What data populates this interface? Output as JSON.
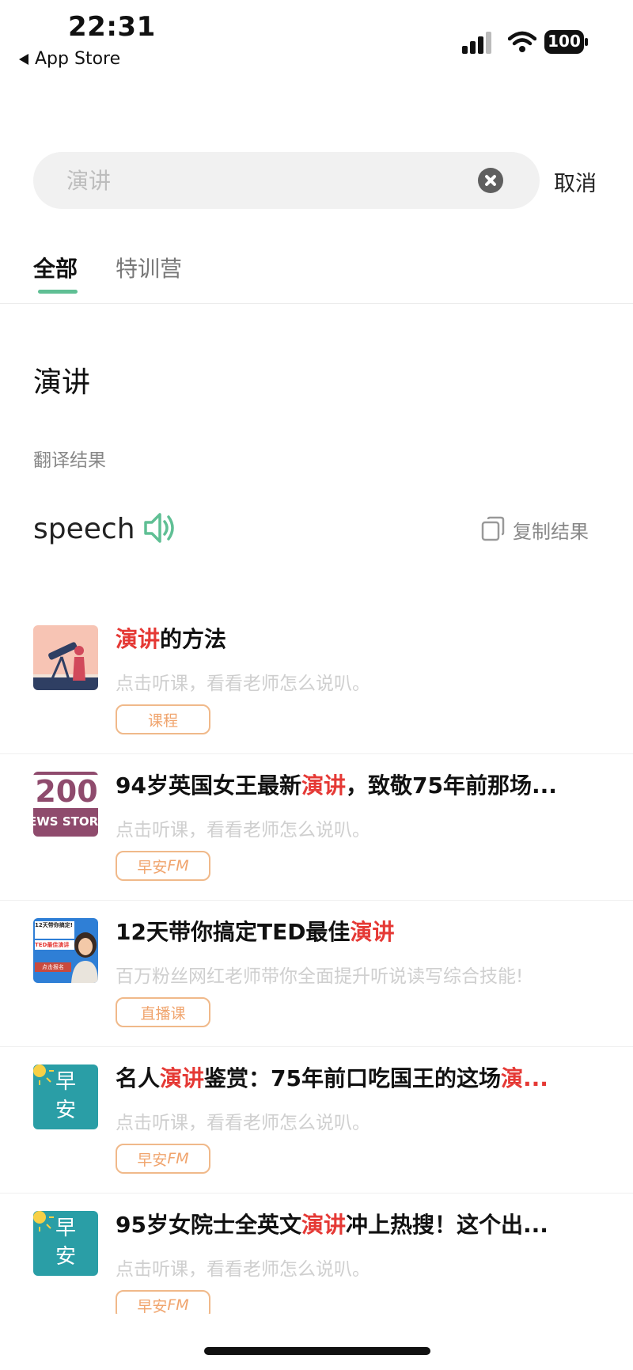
{
  "status_bar": {
    "time": "22:31",
    "back_app": "App Store",
    "battery": "100"
  },
  "search": {
    "placeholder": "演讲",
    "cancel_label": "取消"
  },
  "tabs": [
    {
      "label": "全部",
      "active": true
    },
    {
      "label": "特训营",
      "active": false
    }
  ],
  "dictionary": {
    "query": "演讲",
    "translation_label": "翻译结果",
    "translation": "speech",
    "copy_label": "复制结果"
  },
  "results": [
    {
      "title_highlight": "演讲",
      "title_rest": "的方法",
      "subtitle": "点击听课，看看老师怎么说叭。",
      "tag": "课程"
    },
    {
      "title_prefix": "94岁英国女王最新",
      "title_highlight": "演讲",
      "title_rest": "，致敬75年前那场...",
      "subtitle": "点击听课，看看老师怎么说叭。",
      "tag_main": "早安",
      "tag_suffix": "FM"
    },
    {
      "title_prefix": "12天带你搞定TED最佳",
      "title_highlight": "演讲",
      "subtitle": "百万粉丝网红老师带你全面提升听说读写综合技能!",
      "tag": "直播课"
    },
    {
      "title_prefix": "名人",
      "title_highlight": "演讲",
      "title_rest": "鉴赏：75年前口吃国王的这场",
      "title_highlight2": "演...",
      "subtitle": "点击听课，看看老师怎么说叭。",
      "tag_main": "早安",
      "tag_suffix": "FM"
    },
    {
      "title_prefix": "95岁女院士全英文",
      "title_highlight": "演讲",
      "title_rest": "冲上热搜！这个出...",
      "subtitle": "点击听课，看看老师怎么说叭。",
      "tag_main": "早安",
      "tag_suffix": "FM"
    }
  ],
  "thumbnails": {
    "item2_text1": "200",
    "item2_text2": "EWS STORIE",
    "item3_text1": "12天带你搞定!",
    "item3_text2": "TED最佳演讲",
    "item3_text3": "点击报名",
    "zaoan_text1": "早",
    "zaoan_text2": "安"
  },
  "colors": {
    "accent_green": "#5fbf94",
    "highlight_red": "#e53935",
    "tag_orange": "#f0a46d"
  }
}
